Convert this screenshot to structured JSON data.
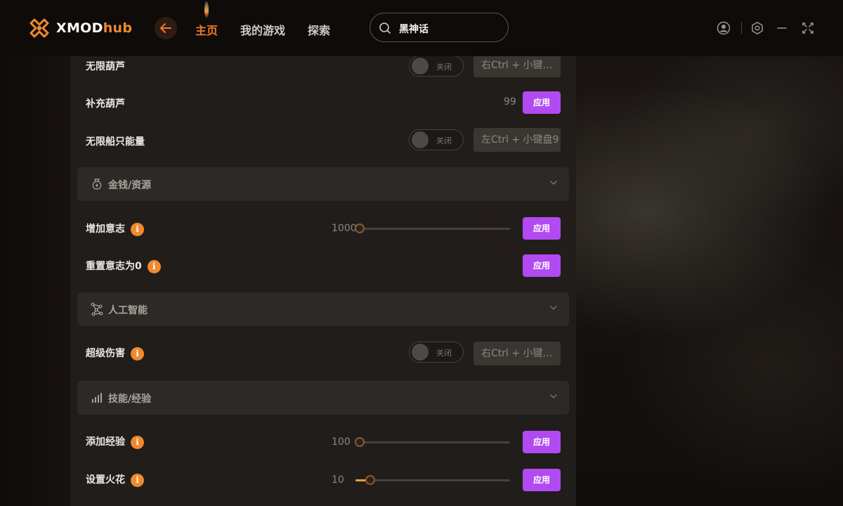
{
  "app": {
    "name_part1": "XMOD",
    "name_part2": "hub"
  },
  "nav": {
    "home": "主页",
    "my_games": "我的游戏",
    "explore": "探索"
  },
  "search": {
    "value": "黑神话"
  },
  "rows": {
    "infinite_gourd": {
      "label": "无限葫芦",
      "toggle": "关闭",
      "hotkey": "右Ctrl + 小键…"
    },
    "refill_gourd": {
      "label": "补充葫芦",
      "value": "99",
      "apply": "应用"
    },
    "infinite_boat": {
      "label": "无限船只能量",
      "toggle": "关闭",
      "hotkey": "左Ctrl + 小键盘9"
    },
    "add_will": {
      "label": "增加意志",
      "value": "1000",
      "slider_fraction": 0.0,
      "apply": "应用"
    },
    "reset_will": {
      "label": "重置意志为0",
      "apply": "应用"
    },
    "super_damage": {
      "label": "超级伤害",
      "toggle": "关闭",
      "hotkey": "右Ctrl + 小键…"
    },
    "add_exp": {
      "label": "添加经验",
      "value": "100",
      "slider_fraction": 0.0,
      "apply": "应用"
    },
    "set_spark": {
      "label": "设置火花",
      "value": "10",
      "slider_fraction": 0.07,
      "apply": "应用"
    }
  },
  "sections": {
    "money": {
      "title": "金钱/资源",
      "icon": "money-bag-icon"
    },
    "ai": {
      "title": "人工智能",
      "icon": "ai-network-icon"
    },
    "skills": {
      "title": "技能/经验",
      "icon": "bar-chart-icon"
    }
  },
  "info_glyph": "i",
  "colors": {
    "accent": "#f08a2c",
    "apply": "#b14af0",
    "panel": "#221e1c"
  }
}
